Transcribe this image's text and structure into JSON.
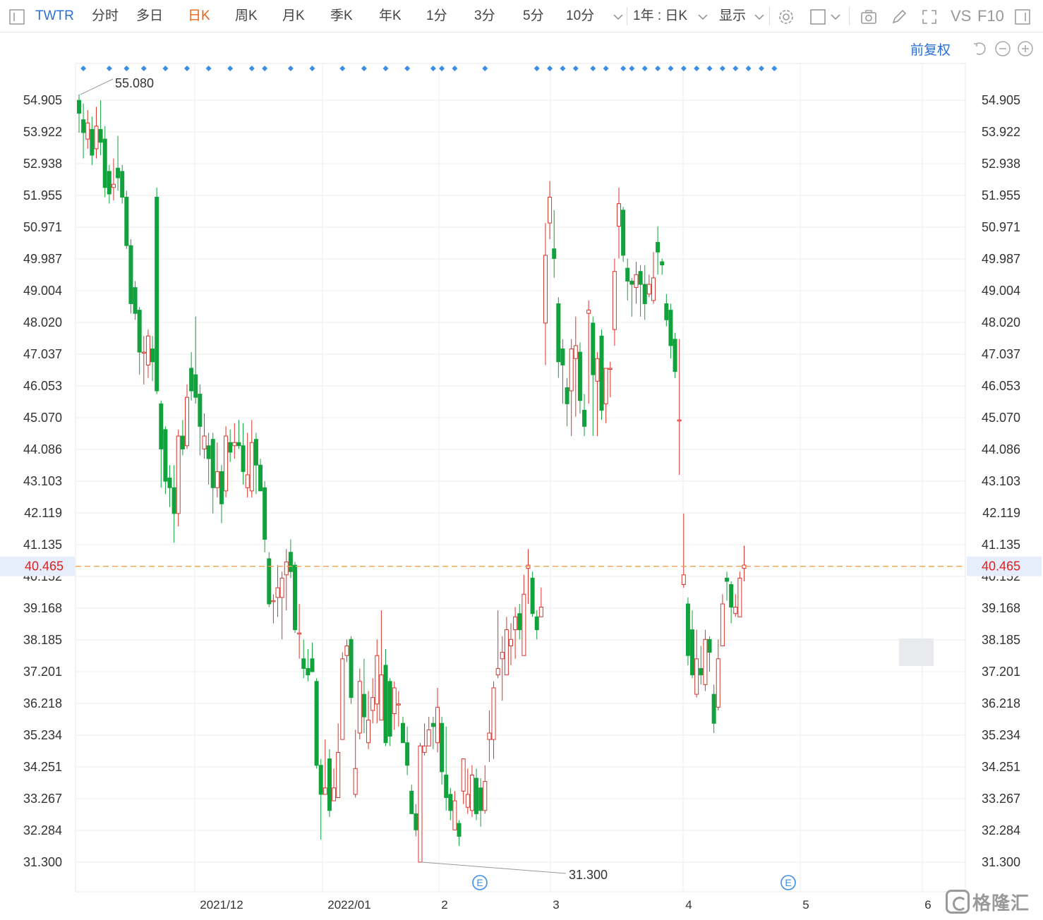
{
  "toolbar": {
    "symbol": "TWTR",
    "periods": [
      "分时",
      "多日",
      "日K",
      "周K",
      "月K",
      "季K",
      "年K",
      "1分",
      "3分",
      "5分",
      "10分"
    ],
    "active_period": "日K",
    "range_select": "1年 : 日K",
    "display_select": "显示",
    "vs_label": "VS",
    "f10_label": "F10"
  },
  "subbar": {
    "adjust_label": "前复权"
  },
  "colors": {
    "up": "#d9342b",
    "down": "#12a23d",
    "grid": "#eeeeee",
    "accent": "#2a6fd6",
    "price_line": "#f0a050"
  },
  "chart_data": {
    "type": "candlestick",
    "symbol": "TWTR",
    "y_ticks": [
      "54.905",
      "53.922",
      "52.938",
      "51.955",
      "50.971",
      "49.987",
      "49.004",
      "48.020",
      "47.037",
      "46.053",
      "45.070",
      "44.086",
      "43.103",
      "42.119",
      "41.135",
      "40.152",
      "39.168",
      "38.185",
      "37.201",
      "36.218",
      "35.234",
      "34.251",
      "33.267",
      "32.284",
      "31.300"
    ],
    "ylim": [
      31.3,
      54.905
    ],
    "x_labels": [
      "2021/12",
      "2022/01",
      "2",
      "3",
      "4",
      "5",
      "6"
    ],
    "current_price": "40.465",
    "max_label": "55.080",
    "min_label": "31.300",
    "event_markers": [
      "E",
      "E"
    ],
    "candles": [
      [
        54.9,
        54.5,
        55.08,
        53.9
      ],
      [
        54.3,
        53.9,
        54.8,
        53.1
      ],
      [
        53.7,
        54.2,
        54.6,
        53.4
      ],
      [
        54.0,
        53.2,
        54.4,
        52.9
      ],
      [
        53.4,
        54.1,
        54.7,
        53.1
      ],
      [
        54.0,
        53.6,
        54.9,
        53.2
      ],
      [
        53.7,
        52.2,
        54.1,
        51.9
      ],
      [
        52.7,
        52.0,
        52.9,
        51.7
      ],
      [
        52.2,
        52.3,
        53.1,
        51.8
      ],
      [
        52.8,
        52.5,
        53.8,
        52.1
      ],
      [
        52.7,
        51.9,
        52.9,
        51.7
      ],
      [
        51.9,
        50.4,
        52.1,
        50.3
      ],
      [
        50.4,
        48.6,
        50.6,
        48.3
      ],
      [
        49.1,
        48.3,
        49.3,
        48.1
      ],
      [
        48.4,
        47.1,
        48.5,
        46.4
      ],
      [
        47.1,
        47.1,
        47.6,
        46.1
      ],
      [
        46.7,
        47.6,
        47.8,
        46.3
      ],
      [
        47.2,
        46.8,
        47.6,
        46.2
      ],
      [
        51.9,
        45.9,
        52.2,
        45.8
      ],
      [
        45.5,
        44.1,
        45.6,
        42.9
      ],
      [
        44.7,
        43.1,
        44.8,
        42.7
      ],
      [
        43.2,
        42.9,
        43.6,
        42.3
      ],
      [
        42.9,
        42.1,
        43.6,
        41.2
      ],
      [
        42.1,
        44.5,
        44.7,
        41.7
      ],
      [
        44.5,
        44.1,
        45.0,
        43.9
      ],
      [
        44.2,
        45.7,
        46.1,
        44.1
      ],
      [
        46.6,
        45.9,
        47.1,
        45.6
      ],
      [
        46.4,
        45.7,
        48.2,
        45.5
      ],
      [
        45.8,
        44.8,
        46.1,
        43.9
      ],
      [
        44.1,
        44.5,
        45.2,
        43.8
      ],
      [
        44.2,
        43.8,
        44.6,
        43.0
      ],
      [
        44.4,
        42.9,
        44.6,
        42.1
      ],
      [
        42.9,
        43.4,
        44.3,
        42.6
      ],
      [
        43.4,
        42.4,
        43.6,
        41.8
      ],
      [
        42.8,
        44.5,
        44.8,
        42.6
      ],
      [
        44.3,
        44.0,
        44.7,
        43.7
      ],
      [
        44.2,
        44.3,
        44.9,
        43.8
      ],
      [
        44.3,
        44.2,
        45.0,
        44.1
      ],
      [
        44.2,
        43.4,
        44.9,
        43.0
      ],
      [
        42.9,
        43.3,
        44.6,
        42.6
      ],
      [
        42.8,
        44.3,
        45.0,
        42.6
      ],
      [
        44.4,
        43.6,
        44.6,
        42.7
      ],
      [
        43.6,
        42.8,
        43.8,
        42.8
      ],
      [
        42.9,
        41.3,
        43.1,
        40.9
      ],
      [
        40.7,
        39.3,
        40.9,
        39.2
      ],
      [
        39.4,
        39.4,
        39.6,
        38.7
      ],
      [
        39.5,
        39.8,
        40.5,
        38.9
      ],
      [
        39.5,
        40.1,
        40.3,
        38.2
      ],
      [
        40.2,
        40.6,
        41.0,
        39.1
      ],
      [
        40.9,
        40.3,
        41.3,
        40.1
      ],
      [
        40.5,
        38.5,
        40.6,
        38.4
      ],
      [
        38.4,
        38.4,
        39.3,
        37.6
      ],
      [
        37.6,
        37.3,
        38.2,
        37.0
      ],
      [
        37.3,
        37.1,
        37.9,
        36.9
      ],
      [
        37.6,
        37.2,
        38.1,
        37.2
      ],
      [
        36.9,
        34.3,
        37.0,
        34.2
      ],
      [
        34.3,
        33.4,
        34.5,
        32.0
      ],
      [
        33.4,
        33.6,
        35.1,
        33.5
      ],
      [
        34.5,
        32.9,
        34.8,
        32.7
      ],
      [
        33.2,
        33.6,
        34.2,
        33.2
      ],
      [
        33.3,
        34.7,
        35.6,
        33.4
      ],
      [
        35.1,
        37.6,
        37.8,
        35.1
      ],
      [
        37.7,
        38.0,
        38.2,
        37.5
      ],
      [
        38.2,
        36.4,
        38.3,
        36.2
      ],
      [
        33.4,
        34.2,
        35.4,
        33.3
      ],
      [
        35.3,
        36.9,
        37.3,
        35.1
      ],
      [
        36.5,
        35.8,
        37.6,
        35.3
      ],
      [
        35.0,
        35.7,
        36.6,
        34.8
      ],
      [
        36.0,
        36.4,
        37.0,
        35.6
      ],
      [
        36.2,
        37.7,
        38.2,
        35.6
      ],
      [
        35.7,
        37.1,
        39.1,
        35.7
      ],
      [
        37.4,
        35.0,
        37.9,
        34.9
      ],
      [
        36.9,
        35.2,
        37.0,
        34.9
      ],
      [
        35.9,
        36.7,
        36.9,
        35.4
      ],
      [
        36.2,
        36.2,
        36.6,
        35.5
      ],
      [
        35.6,
        35.0,
        35.8,
        35.0
      ],
      [
        35.0,
        34.3,
        35.5,
        34.0
      ],
      [
        33.5,
        32.8,
        33.7,
        32.8
      ],
      [
        32.8,
        32.3,
        33.1,
        32.1
      ],
      [
        31.3,
        34.9,
        35.0,
        31.3
      ],
      [
        34.7,
        34.9,
        35.6,
        34.6
      ],
      [
        34.9,
        35.4,
        35.8,
        35.2
      ],
      [
        35.6,
        35.5,
        35.8,
        34.8
      ],
      [
        35.0,
        36.1,
        36.7,
        34.7
      ],
      [
        35.6,
        34.1,
        35.8,
        33.7
      ],
      [
        34.0,
        33.3,
        35.5,
        32.9
      ],
      [
        33.4,
        32.9,
        33.6,
        32.6
      ],
      [
        32.3,
        33.2,
        33.5,
        32.3
      ],
      [
        32.5,
        32.1,
        32.6,
        31.8
      ],
      [
        33.5,
        34.5,
        34.5,
        33.1
      ],
      [
        33.0,
        33.4,
        34.2,
        32.8
      ],
      [
        32.9,
        34.0,
        34.3,
        32.7
      ],
      [
        33.9,
        32.8,
        34.2,
        32.6
      ],
      [
        33.6,
        32.9,
        33.9,
        32.4
      ],
      [
        32.9,
        33.8,
        34.3,
        32.8
      ],
      [
        35.1,
        35.3,
        36.0,
        34.4
      ],
      [
        35.1,
        36.7,
        36.9,
        34.5
      ],
      [
        37.1,
        37.3,
        39.1,
        37.0
      ],
      [
        37.6,
        37.8,
        38.3,
        36.3
      ],
      [
        37.1,
        38.5,
        38.9,
        37.5
      ],
      [
        38.0,
        38.2,
        38.7,
        37.4
      ],
      [
        38.5,
        38.9,
        39.2,
        37.6
      ],
      [
        39.0,
        38.5,
        39.3,
        38.2
      ],
      [
        37.7,
        39.6,
        40.2,
        37.9
      ],
      [
        40.4,
        40.5,
        41.0,
        39.3
      ],
      [
        40.1,
        39.0,
        40.3,
        38.9
      ],
      [
        38.9,
        38.5,
        39.1,
        38.2
      ],
      [
        38.9,
        39.2,
        39.8,
        39.0
      ],
      [
        48.0,
        50.1,
        51.1,
        46.7
      ],
      [
        51.1,
        51.9,
        52.4,
        50.6
      ],
      [
        50.3,
        50.0,
        51.5,
        49.4
      ],
      [
        48.6,
        46.8,
        48.8,
        46.3
      ],
      [
        47.2,
        46.7,
        47.5,
        45.5
      ],
      [
        46.0,
        45.5,
        46.3,
        44.8
      ],
      [
        45.9,
        47.2,
        47.5,
        44.5
      ],
      [
        46.9,
        47.3,
        48.2,
        45.1
      ],
      [
        47.1,
        45.6,
        47.4,
        45.2
      ],
      [
        45.3,
        44.8,
        45.8,
        44.5
      ],
      [
        48.3,
        48.4,
        48.7,
        45.5
      ],
      [
        48.0,
        46.4,
        48.2,
        44.5
      ],
      [
        46.2,
        46.9,
        47.1,
        44.5
      ],
      [
        47.6,
        45.3,
        47.8,
        45.0
      ],
      [
        45.5,
        46.6,
        46.6,
        44.9
      ],
      [
        46.6,
        46.6,
        46.8,
        45.7
      ],
      [
        47.8,
        49.6,
        50.0,
        47.3
      ],
      [
        51.0,
        51.7,
        52.2,
        50.0
      ],
      [
        51.5,
        50.1,
        51.6,
        49.9
      ],
      [
        49.7,
        49.3,
        50.0,
        48.7
      ],
      [
        49.3,
        49.2,
        49.4,
        48.2
      ],
      [
        49.1,
        49.5,
        49.9,
        48.6
      ],
      [
        49.6,
        49.2,
        49.8,
        48.2
      ],
      [
        49.2,
        48.6,
        49.8,
        48.1
      ],
      [
        48.9,
        49.2,
        49.5,
        48.8
      ],
      [
        48.7,
        49.4,
        50.2,
        48.6
      ],
      [
        50.5,
        50.2,
        51.0,
        49.5
      ],
      [
        49.9,
        49.8,
        50.0,
        49.5
      ],
      [
        48.6,
        48.1,
        48.9,
        47.9
      ],
      [
        48.4,
        47.3,
        48.6,
        46.9
      ],
      [
        47.5,
        46.5,
        47.7,
        46.3
      ],
      [
        45.0,
        45.0,
        47.5,
        43.3
      ],
      [
        39.9,
        40.2,
        42.1,
        39.8
      ],
      [
        39.3,
        37.7,
        39.5,
        37.4
      ],
      [
        38.5,
        37.1,
        39.1,
        37.0
      ],
      [
        36.5,
        37.6,
        38.5,
        36.4
      ],
      [
        37.3,
        37.1,
        38.0,
        36.8
      ],
      [
        36.8,
        38.2,
        38.5,
        36.6
      ],
      [
        38.2,
        37.8,
        38.3,
        37.2
      ],
      [
        36.5,
        35.6,
        36.8,
        35.3
      ],
      [
        36.1,
        37.6,
        38.2,
        36.0
      ],
      [
        38.0,
        39.3,
        39.6,
        38.0
      ],
      [
        40.1,
        40.0,
        40.3,
        39.4
      ],
      [
        39.9,
        39.2,
        40.0,
        38.7
      ],
      [
        39.0,
        39.2,
        39.6,
        38.9
      ],
      [
        38.9,
        40.1,
        40.3,
        38.9
      ],
      [
        40.4,
        40.5,
        41.1,
        40.0
      ]
    ]
  }
}
